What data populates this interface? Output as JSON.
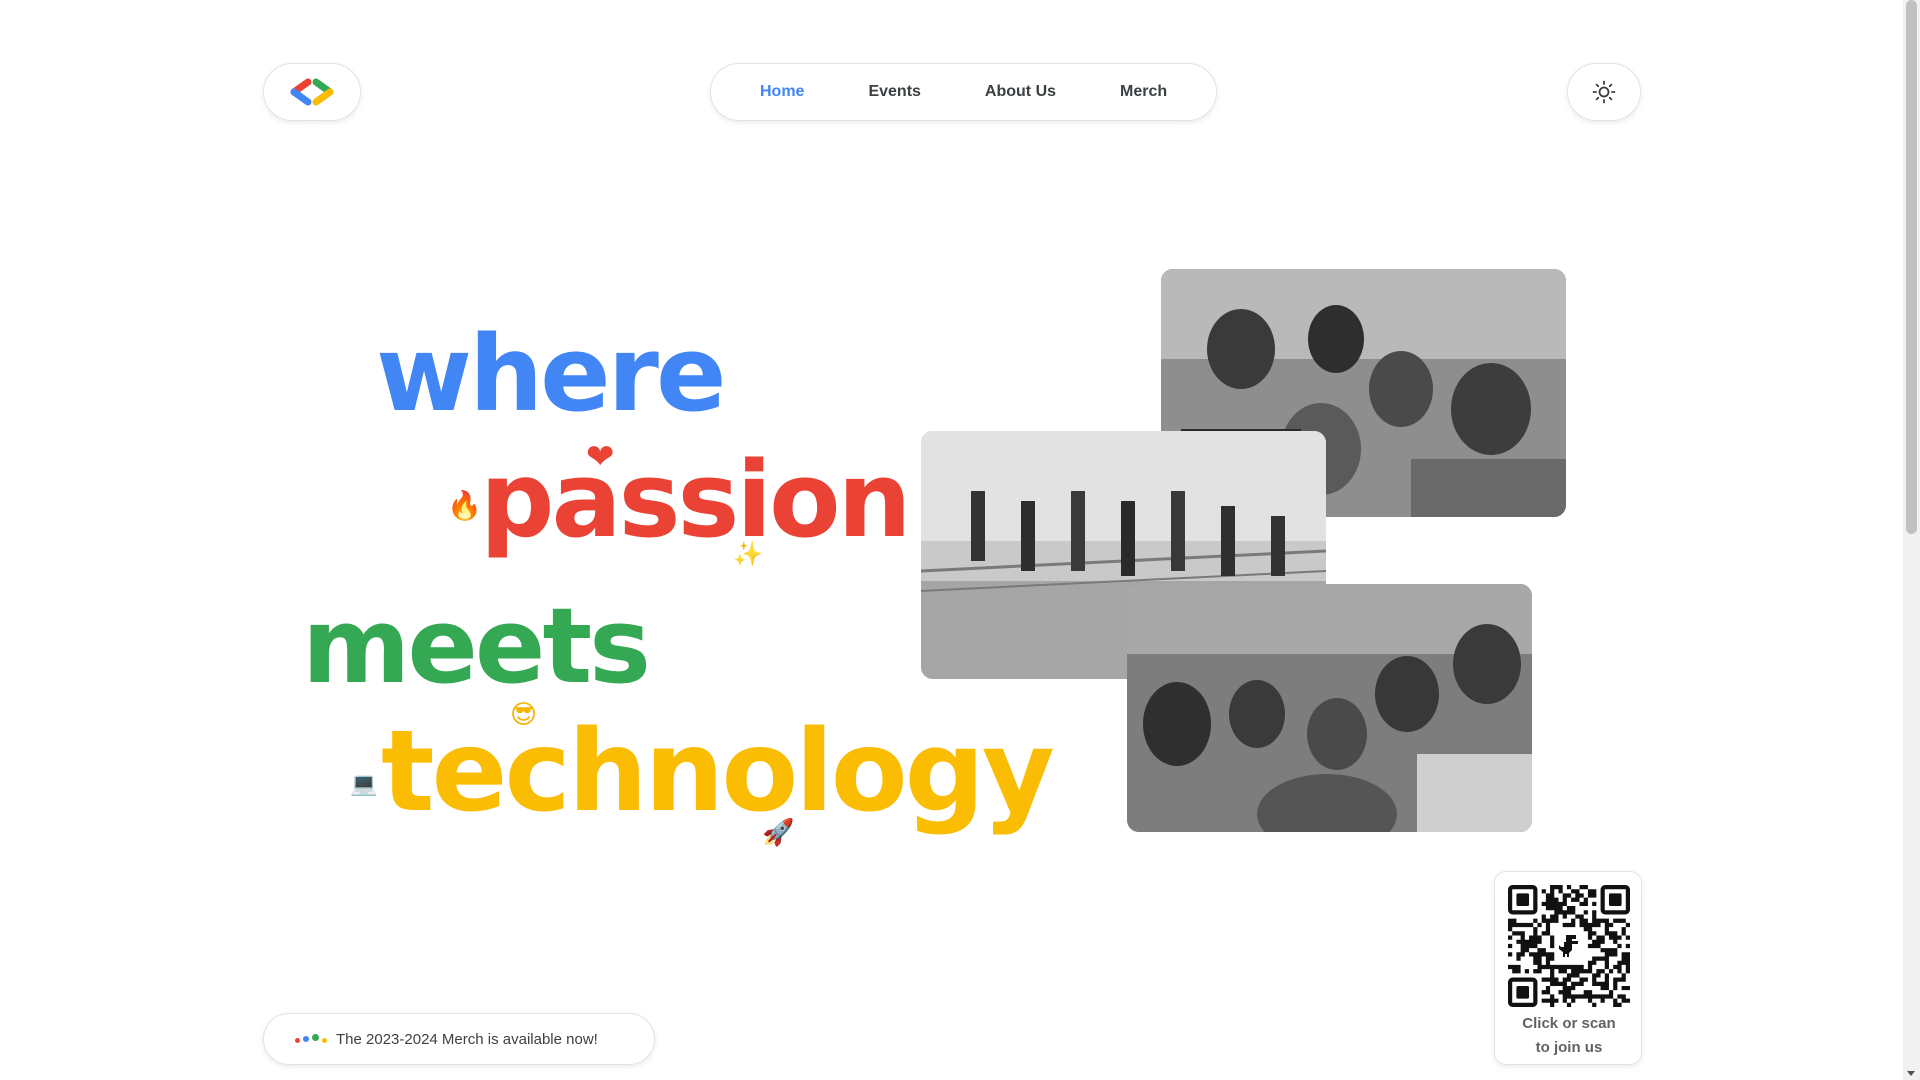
{
  "header": {
    "logo_icon": "gdsc-brackets-logo-icon",
    "nav": [
      {
        "label": "Home",
        "active": true
      },
      {
        "label": "Events",
        "active": false
      },
      {
        "label": "About Us",
        "active": false
      },
      {
        "label": "Merch",
        "active": false
      }
    ],
    "theme_icon": "sun-icon"
  },
  "hero": {
    "words": [
      {
        "text": "where",
        "color": "#4285f4"
      },
      {
        "text": "passion",
        "color": "#ea4335"
      },
      {
        "text": "meets",
        "color": "#34a853"
      },
      {
        "text": "technology",
        "color": "#fbbc04"
      }
    ],
    "emojis": {
      "heart": "❤",
      "fire": "🔥",
      "sparkles": "✨",
      "cool": "😎",
      "laptop": "💻",
      "rocket": "🚀"
    }
  },
  "photos": [
    {
      "icon": "group-photo-icon"
    },
    {
      "icon": "group-photo-icon"
    },
    {
      "icon": "group-photo-icon"
    }
  ],
  "qr": {
    "icon": "qr-code-icon",
    "text_line1": "Click or scan",
    "text_line2": "to join us"
  },
  "banner": {
    "text": "The 2023-2024 Merch is available now!",
    "dot_colors": [
      "#ea4335",
      "#4285f4",
      "#34a853",
      "#fbbc04"
    ]
  },
  "colors": {
    "blue": "#4285f4",
    "red": "#ea4335",
    "green": "#34a853",
    "yellow": "#fbbc04"
  }
}
